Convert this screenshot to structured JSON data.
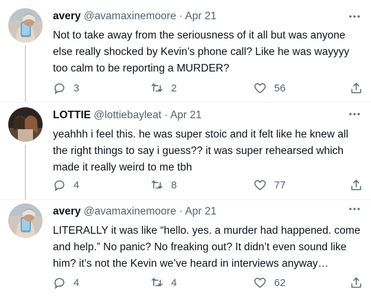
{
  "tweets": [
    {
      "name": "avery",
      "handle": "@avamaxinemoore",
      "separator": "·",
      "date": "Apr 21",
      "more_icon": "more-horizontal-icon",
      "text": "Not to take away from the seriousness of it all but was anyone else really shocked by Kevin’s phone call? Like he was wayyyy too calm to be reporting a MURDER?",
      "replies": "3",
      "retweets": "2",
      "likes": "56"
    },
    {
      "name": "LOTTIE",
      "handle": "@lottiebayleat",
      "separator": "·",
      "date": "Apr 21",
      "more_icon": "more-horizontal-icon",
      "text": "yeahhh i feel this. he was super stoic and it felt like he knew all the right things to say i guess?? it was super rehearsed which made it really weird to me tbh",
      "replies": "4",
      "retweets": "8",
      "likes": "77"
    },
    {
      "name": "avery",
      "handle": "@avamaxinemoore",
      "separator": "·",
      "date": "Apr 21",
      "more_icon": "more-horizontal-icon",
      "text": "LITERALLY it was like “hello. yes. a murder had happened. come and help.” No panic? No freaking out? It didn’t even sound like him? it’s not the Kevin we’ve heard in interviews anyway…",
      "replies": "4",
      "retweets": "4",
      "likes": "62"
    }
  ],
  "icons": {
    "reply": "reply-icon",
    "retweet": "retweet-icon",
    "like": "heart-icon",
    "share": "share-icon"
  },
  "colors": {
    "text": "#0f1419",
    "secondary": "#536471",
    "thread_line": "#cfd9de",
    "divider": "#eff3f4"
  }
}
